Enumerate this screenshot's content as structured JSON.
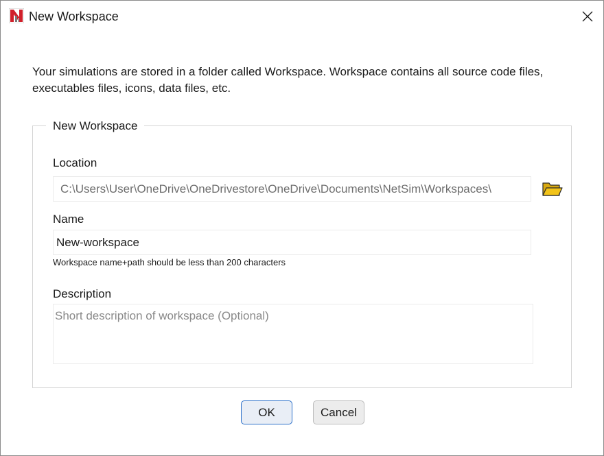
{
  "window": {
    "title": "New Workspace",
    "app_icon": "netsim-logo-icon",
    "close_icon": "close-icon"
  },
  "intro": {
    "text": "Your simulations are stored in a folder called Workspace. Workspace contains all source code files, executables files, icons, data files, etc."
  },
  "group": {
    "legend": "New Workspace"
  },
  "location": {
    "label": "Location",
    "value": "C:\\Users\\User\\OneDrive\\OneDrivestore\\OneDrive\\Documents\\NetSim\\Workspaces\\",
    "browse_icon": "folder-open-icon"
  },
  "name": {
    "label": "Name",
    "value": "New-workspace",
    "hint": "Workspace name+path should be less than 200 characters"
  },
  "description": {
    "label": "Description",
    "value": "",
    "placeholder": "Short description of workspace (Optional)"
  },
  "buttons": {
    "ok_label": "OK",
    "cancel_label": "Cancel"
  },
  "colors": {
    "accent": "#2a6fc9",
    "logo_red": "#d0202a",
    "folder_yellow": "#f2c318"
  }
}
